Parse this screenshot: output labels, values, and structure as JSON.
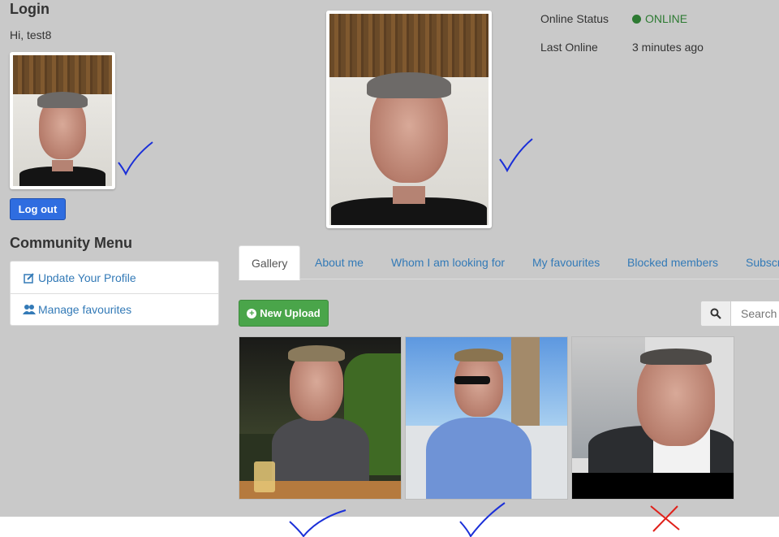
{
  "login": {
    "title": "Login",
    "greeting": "Hi, test8",
    "logout_label": "Log out"
  },
  "community": {
    "title": "Community Menu",
    "items": [
      {
        "label": "Update Your Profile",
        "icon": "edit-icon"
      },
      {
        "label": "Manage favourites",
        "icon": "users-icon"
      }
    ]
  },
  "status": {
    "online_label": "Online Status",
    "online_value": "ONLINE",
    "last_label": "Last Online",
    "last_value": "3 minutes ago",
    "online_color": "#2d7a32"
  },
  "tabs": [
    {
      "label": "Gallery",
      "active": true
    },
    {
      "label": "About me"
    },
    {
      "label": "Whom I am looking for"
    },
    {
      "label": "My favourites"
    },
    {
      "label": "Blocked members"
    },
    {
      "label": "Subscr"
    }
  ],
  "gallery": {
    "upload_label": "New Upload",
    "search_placeholder": "Search"
  },
  "annotations": {
    "check_color": "#1a2fd8",
    "cross_color": "#e0201a"
  }
}
